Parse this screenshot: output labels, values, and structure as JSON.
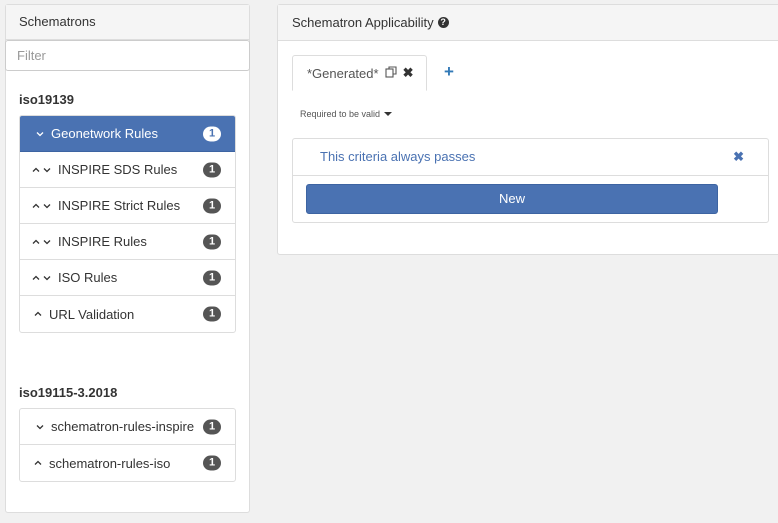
{
  "left_panel": {
    "title": "Schematrons",
    "filter_placeholder": "Filter",
    "groups": [
      {
        "name": "iso19139",
        "items": [
          {
            "label": "Geonetwork Rules",
            "count": "1",
            "chevrons": [
              "down"
            ],
            "active": true
          },
          {
            "label": "INSPIRE SDS Rules",
            "count": "1",
            "chevrons": [
              "up",
              "down"
            ]
          },
          {
            "label": "INSPIRE Strict Rules",
            "count": "1",
            "chevrons": [
              "up",
              "down"
            ]
          },
          {
            "label": "INSPIRE Rules",
            "count": "1",
            "chevrons": [
              "up",
              "down"
            ]
          },
          {
            "label": "ISO Rules",
            "count": "1",
            "chevrons": [
              "up",
              "down"
            ]
          },
          {
            "label": "URL Validation",
            "count": "1",
            "chevrons": [
              "up"
            ]
          }
        ]
      },
      {
        "name": "iso19115-3.2018",
        "items": [
          {
            "label": "schematron-rules-inspire",
            "count": "1",
            "chevrons": [
              "down"
            ]
          },
          {
            "label": "schematron-rules-iso",
            "count": "1",
            "chevrons": [
              "up"
            ]
          }
        ]
      }
    ]
  },
  "right_panel": {
    "title": "Schematron Applicability",
    "help_icon": "question-circle-icon",
    "tabs": [
      {
        "label": "*Generated*",
        "icons": [
          "copy-icon",
          "close-icon"
        ]
      }
    ],
    "add_tab_icon": "plus-icon",
    "requirement_dropdown": "Required to be valid",
    "criteria": [
      {
        "label": "This criteria always passes"
      }
    ],
    "new_button": "New"
  },
  "colors": {
    "accent": "#4a72b2",
    "link": "#337ab7",
    "badge": "#555555"
  }
}
